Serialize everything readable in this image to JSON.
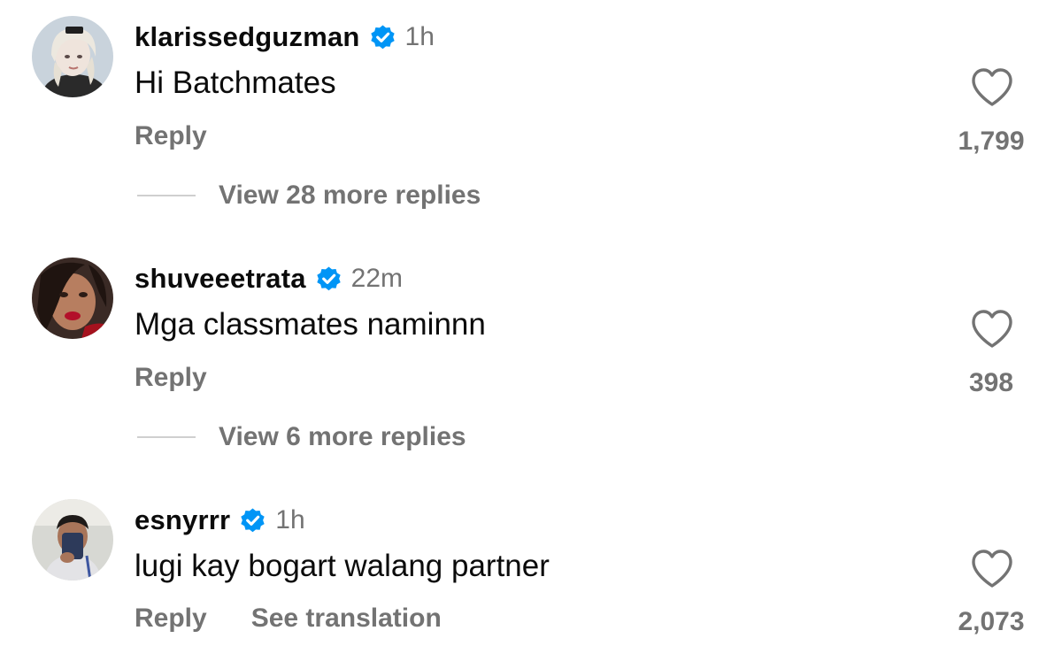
{
  "comments": [
    {
      "username": "klarissedguzman",
      "time": "1h",
      "text": "Hi Batchmates",
      "reply_label": "Reply",
      "likes": "1,799",
      "view_replies": "View 28 more replies",
      "avatar_icon": "avatar-photo-blonde"
    },
    {
      "username": "shuveeetrata",
      "time": "22m",
      "text": "Mga classmates naminnn",
      "reply_label": "Reply",
      "likes": "398",
      "view_replies": "View 6 more replies",
      "avatar_icon": "avatar-photo-red-lips"
    },
    {
      "username": "esnyrrr",
      "time": "1h",
      "text": "lugi kay bogart walang partner",
      "reply_label": "Reply",
      "translate_label": "See translation",
      "likes": "2,073",
      "avatar_icon": "avatar-photo-man"
    }
  ],
  "icons": {
    "verified": "verified-badge-icon",
    "like": "heart-outline-icon"
  },
  "colors": {
    "verified_blue": "#0095f6",
    "secondary_text": "#737373",
    "primary_text": "#0b0b0b"
  }
}
